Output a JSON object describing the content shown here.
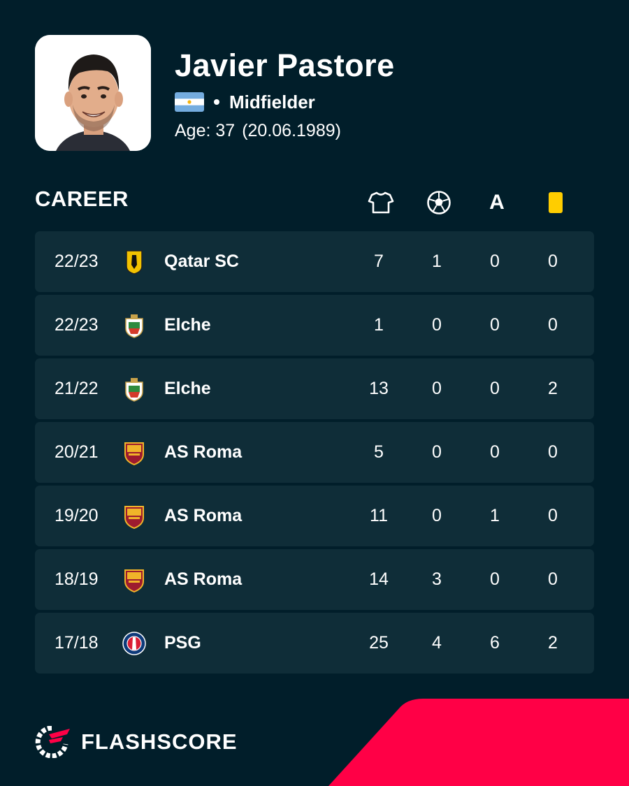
{
  "player": {
    "name": "Javier Pastore",
    "position": "Midfielder",
    "age_label": "Age: 37",
    "birth_date": "(20.06.1989)",
    "flag": "argentina-flag-icon"
  },
  "career": {
    "title": "CAREER",
    "columns": [
      "shirt-icon",
      "ball-icon",
      "A",
      "yellow-card-icon"
    ],
    "assist_header": "A",
    "rows": [
      {
        "season": "22/23",
        "team": "Qatar SC",
        "crest": "qatar-sc-crest-icon",
        "apps": "7",
        "goals": "1",
        "assists": "0",
        "yellow": "0"
      },
      {
        "season": "22/23",
        "team": "Elche",
        "crest": "elche-crest-icon",
        "apps": "1",
        "goals": "0",
        "assists": "0",
        "yellow": "0"
      },
      {
        "season": "21/22",
        "team": "Elche",
        "crest": "elche-crest-icon",
        "apps": "13",
        "goals": "0",
        "assists": "0",
        "yellow": "2"
      },
      {
        "season": "20/21",
        "team": "AS Roma",
        "crest": "roma-crest-icon",
        "apps": "5",
        "goals": "0",
        "assists": "0",
        "yellow": "0"
      },
      {
        "season": "19/20",
        "team": "AS Roma",
        "crest": "roma-crest-icon",
        "apps": "11",
        "goals": "0",
        "assists": "1",
        "yellow": "0"
      },
      {
        "season": "18/19",
        "team": "AS Roma",
        "crest": "roma-crest-icon",
        "apps": "14",
        "goals": "3",
        "assists": "0",
        "yellow": "0"
      },
      {
        "season": "17/18",
        "team": "PSG",
        "crest": "psg-crest-icon",
        "apps": "25",
        "goals": "4",
        "assists": "6",
        "yellow": "2"
      }
    ]
  },
  "brand": {
    "name": "FLASHSCORE",
    "accent": "#ff0046"
  },
  "colors": {
    "background": "#011e2a",
    "row_background": "#0f2d38",
    "yellow_card": "#ffcd00"
  }
}
